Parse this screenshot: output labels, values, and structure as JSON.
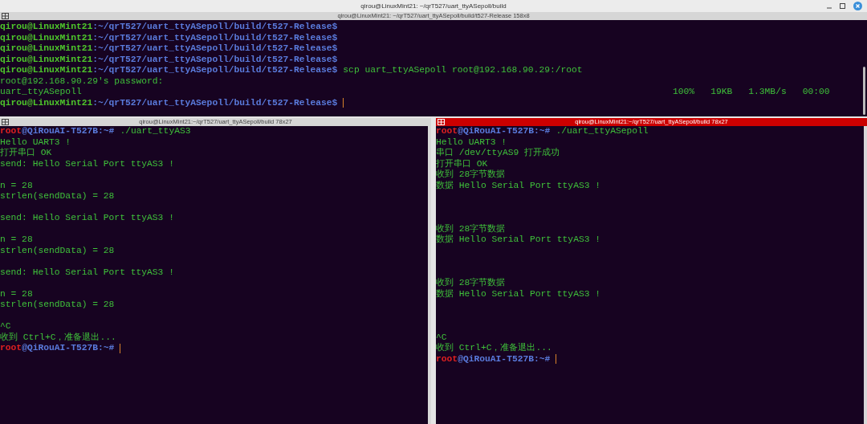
{
  "window": {
    "title": "qirou@LinuxMint21: ~/qrT527/uart_ttyASepoll/build"
  },
  "top_pane": {
    "title": "qirou@LinuxMint21: ~/qrT527/uart_ttyASepoll/build/t527-Release 158x8",
    "selected": false,
    "lines": [
      {
        "kind": "prompt",
        "user": "qirou@LinuxMint21",
        "rest": ":~/qrT527/uart_ttyASepoll/build/t527-Release$",
        "cursor": false
      },
      {
        "kind": "prompt",
        "user": "qirou@LinuxMint21",
        "rest": ":~/qrT527/uart_ttyASepoll/build/t527-Release$",
        "cursor": false
      },
      {
        "kind": "prompt",
        "user": "qirou@LinuxMint21",
        "rest": ":~/qrT527/uart_ttyASepoll/build/t527-Release$",
        "cursor": false
      },
      {
        "kind": "prompt",
        "user": "qirou@LinuxMint21",
        "rest": ":~/qrT527/uart_ttyASepoll/build/t527-Release$",
        "cursor": false
      },
      {
        "kind": "prompt",
        "user": "qirou@LinuxMint21",
        "rest": ":~/qrT527/uart_ttyASepoll/build/t527-Release$",
        "command": "scp uart_ttyASepoll root@192.168.90.29:/root",
        "cursor": false
      },
      {
        "kind": "output",
        "text": "root@192.168.90.29's password:"
      },
      {
        "kind": "progress",
        "file": "uart_ttyASepoll",
        "stats": [
          "100%",
          "19KB",
          "1.3MB/s",
          "00:00"
        ]
      },
      {
        "kind": "prompt",
        "user": "qirou@LinuxMint21",
        "rest": ":~/qrT527/uart_ttyASepoll/build/t527-Release$",
        "cursor": true
      }
    ]
  },
  "bottom_panes": [
    {
      "title": "qirou@LinuxMint21:~/qrT527/uart_ttyASepoll/build 78x27",
      "selected": false,
      "lines": [
        {
          "kind": "prompt",
          "user": "root",
          "rest": "@QiRouAI-T527B:~#",
          "command": "./uart_ttyAS3",
          "cursor": false
        },
        {
          "kind": "output",
          "text": "Hello UART3 !"
        },
        {
          "kind": "output",
          "text": "打开串口 OK"
        },
        {
          "kind": "output",
          "text": "send: Hello Serial Port ttyAS3 !"
        },
        {
          "kind": "blank"
        },
        {
          "kind": "output",
          "text": "n = 28"
        },
        {
          "kind": "output",
          "text": "strlen(sendData) = 28"
        },
        {
          "kind": "blank"
        },
        {
          "kind": "output",
          "text": "send: Hello Serial Port ttyAS3 !"
        },
        {
          "kind": "blank"
        },
        {
          "kind": "output",
          "text": "n = 28"
        },
        {
          "kind": "output",
          "text": "strlen(sendData) = 28"
        },
        {
          "kind": "blank"
        },
        {
          "kind": "output",
          "text": "send: Hello Serial Port ttyAS3 !"
        },
        {
          "kind": "blank"
        },
        {
          "kind": "output",
          "text": "n = 28"
        },
        {
          "kind": "output",
          "text": "strlen(sendData) = 28"
        },
        {
          "kind": "blank"
        },
        {
          "kind": "output",
          "text": "^C"
        },
        {
          "kind": "output",
          "text": "收到 Ctrl+C，准备退出..."
        },
        {
          "kind": "prompt",
          "user": "root",
          "rest": "@QiRouAI-T527B:~#",
          "cursor": true
        }
      ]
    },
    {
      "title": "qirou@LinuxMint21:~/qrT527/uart_ttyASepoll/build 78x27",
      "selected": true,
      "lines": [
        {
          "kind": "prompt",
          "user": "root",
          "rest": "@QiRouAI-T527B:~#",
          "command": "./uart_ttyASepoll",
          "cursor": false
        },
        {
          "kind": "output",
          "text": "Hello UART3 !"
        },
        {
          "kind": "output",
          "text": "串口 /dev/ttyAS9 打开成功"
        },
        {
          "kind": "output",
          "text": "打开串口 OK"
        },
        {
          "kind": "output",
          "text": "收到 28字节数据"
        },
        {
          "kind": "output",
          "text": "数据 Hello Serial Port ttyAS3 !"
        },
        {
          "kind": "blank"
        },
        {
          "kind": "blank"
        },
        {
          "kind": "blank"
        },
        {
          "kind": "output",
          "text": "收到 28字节数据"
        },
        {
          "kind": "output",
          "text": "数据 Hello Serial Port ttyAS3 !"
        },
        {
          "kind": "blank"
        },
        {
          "kind": "blank"
        },
        {
          "kind": "blank"
        },
        {
          "kind": "output",
          "text": "收到 28字节数据"
        },
        {
          "kind": "output",
          "text": "数据 Hello Serial Port ttyAS3 !"
        },
        {
          "kind": "blank"
        },
        {
          "kind": "blank"
        },
        {
          "kind": "blank"
        },
        {
          "kind": "output",
          "text": "^C"
        },
        {
          "kind": "output",
          "text": "收到 Ctrl+C，准备退出..."
        },
        {
          "kind": "prompt",
          "user": "root",
          "rest": "@QiRouAI-T527B:~#",
          "cursor": true
        }
      ]
    }
  ]
}
